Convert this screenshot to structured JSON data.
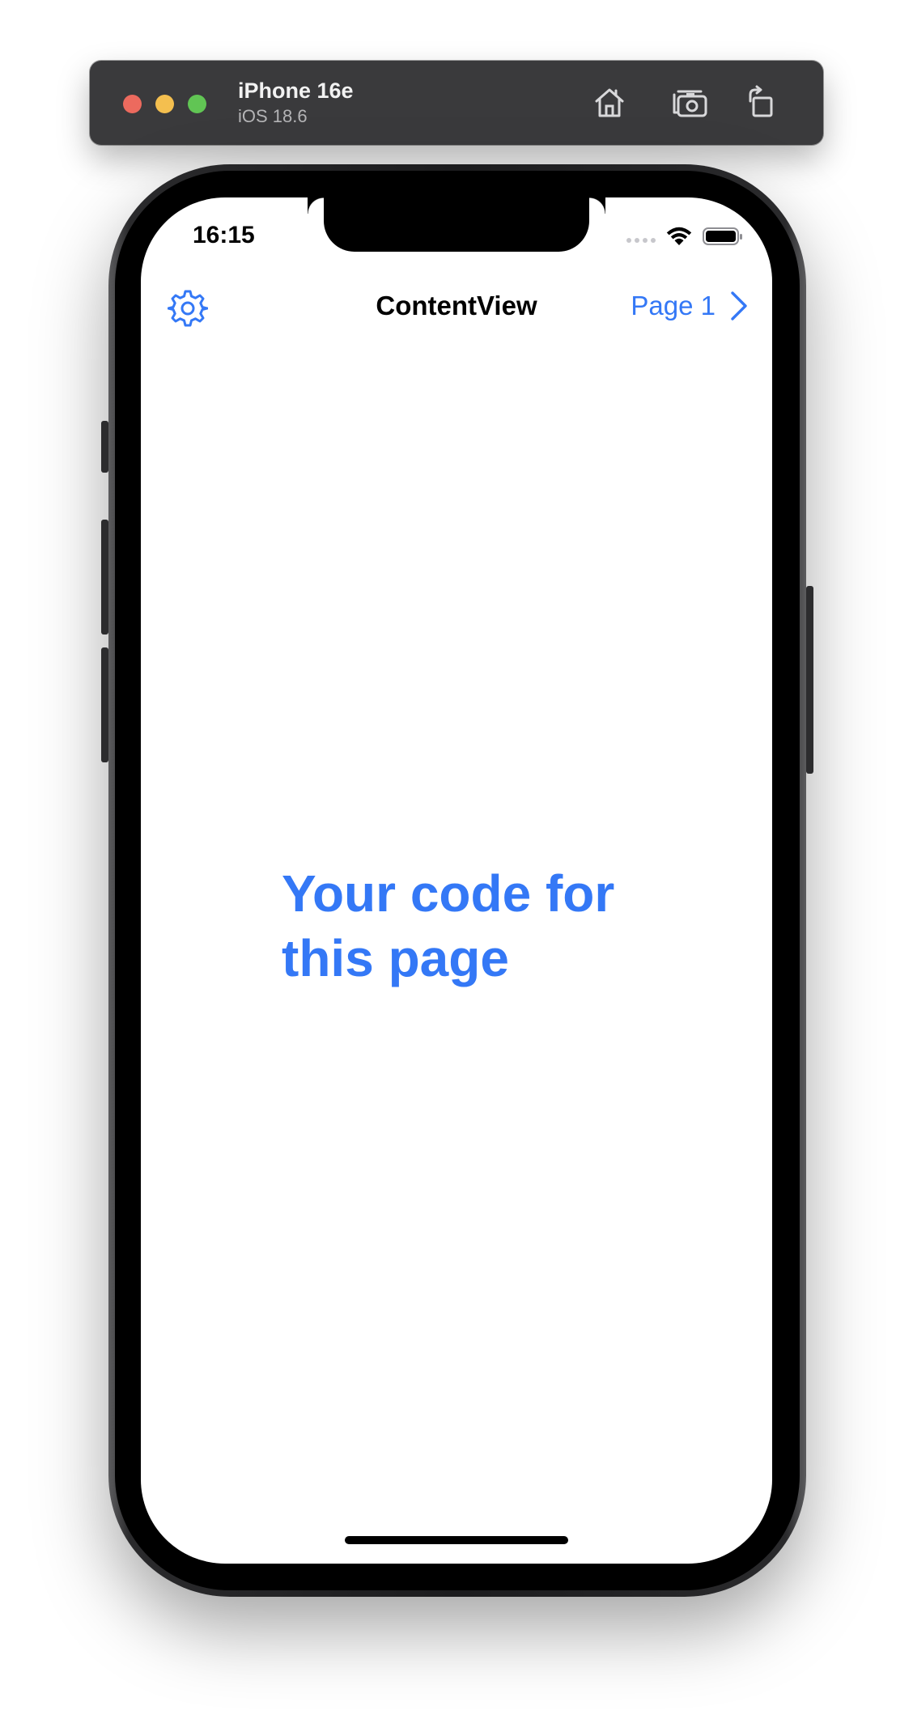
{
  "simulator": {
    "device_name": "iPhone 16e",
    "os_version": "iOS 18.6",
    "colors": {
      "toolbar_bg": "#3a3a3c",
      "close": "#ec6a5e",
      "minimize": "#f4bf4f",
      "zoom": "#61c554"
    },
    "toolbar_icons": [
      "home-icon",
      "screenshot-icon",
      "rotate-icon"
    ]
  },
  "status_bar": {
    "time": "16:15",
    "icons": [
      "cellular-signal-icon",
      "wifi-icon",
      "battery-icon"
    ]
  },
  "nav_bar": {
    "title": "ContentView",
    "leading_icon": "gear-icon",
    "trailing_label": "Page 1",
    "trailing_icon": "chevron-right-icon"
  },
  "content": {
    "text": "Your code for this page"
  },
  "colors": {
    "accent": "#3478f6",
    "screen_bg": "#ffffff"
  }
}
